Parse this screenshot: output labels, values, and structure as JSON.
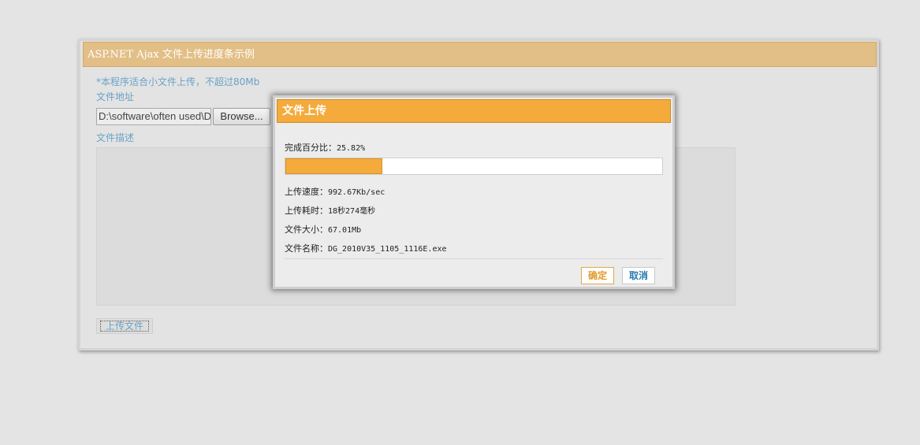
{
  "main": {
    "title": "ASP.NET Ajax 文件上传进度条示例",
    "note": "*本程序适合小文件上传，不超过80Mb",
    "file_label": "文件地址",
    "file_value": "D:\\software\\often used\\D",
    "browse_label": "Browse...",
    "desc_label": "文件描述",
    "upload_label": "上传文件"
  },
  "dialog": {
    "title": "文件上传",
    "percent_label": "完成百分比：",
    "percent_value": "25.82%",
    "progress": 0.2582,
    "speed_label": "上传速度：",
    "speed_value": "992.67Kb/sec",
    "elapsed_label": "上传耗时：",
    "elapsed_value": "18秒274毫秒",
    "size_label": "文件大小：",
    "size_value": "67.01Mb",
    "name_label": "文件名称：",
    "name_value": "DG_2010V35_1105_1116E.exe",
    "ok_label": "确定",
    "cancel_label": "取消"
  },
  "colors": {
    "accent": "#f4ab3c",
    "header_tan": "#e2bf86",
    "link_blue": "#6aa2c8"
  }
}
